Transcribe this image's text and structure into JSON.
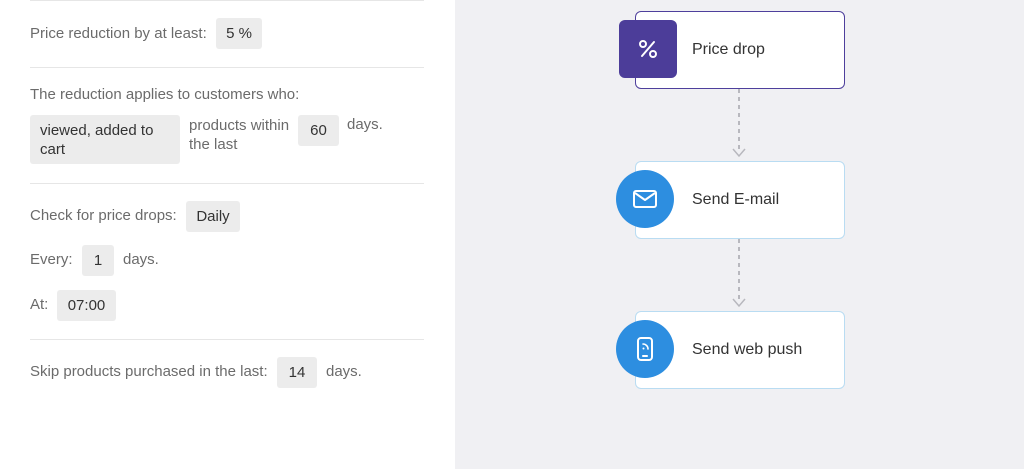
{
  "settings": {
    "price_reduction": {
      "label": "Price reduction by at least:",
      "value": "5 %"
    },
    "applies_to": {
      "heading": "The reduction applies to customers who:",
      "action_value": "viewed, added to cart",
      "mid_text": "products within the last",
      "days_value": "60",
      "days_suffix": "days."
    },
    "check": {
      "label": "Check for price drops:",
      "value": "Daily"
    },
    "every": {
      "label": "Every:",
      "value": "1",
      "suffix": "days."
    },
    "at": {
      "label": "At:",
      "value": "07:00"
    },
    "skip": {
      "label": "Skip products purchased in the last:",
      "value": "14",
      "suffix": "days."
    }
  },
  "workflow": {
    "nodes": [
      {
        "label": "Price drop",
        "icon": "percent-icon",
        "color": "#4c3d99"
      },
      {
        "label": "Send E-mail",
        "icon": "envelope-icon",
        "color": "#2d8ee0"
      },
      {
        "label": "Send web push",
        "icon": "mobile-push-icon",
        "color": "#2d8ee0"
      }
    ]
  }
}
